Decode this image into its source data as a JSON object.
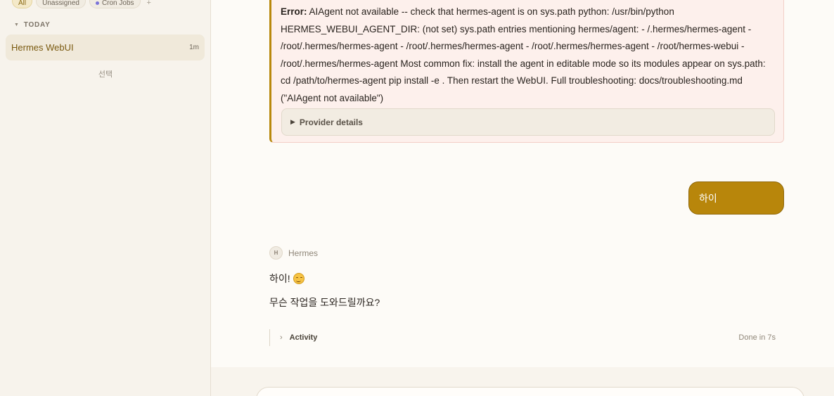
{
  "sidebar": {
    "filters": [
      {
        "label": "All",
        "active": true
      },
      {
        "label": "Unassigned",
        "active": false
      },
      {
        "label": "Cron Jobs",
        "active": false,
        "dot_color": "#7b74d9"
      }
    ],
    "add_filter_label": "+",
    "section": {
      "label": "TODAY"
    },
    "sessions": [
      {
        "title": "Hermes WebUI",
        "time": "1m"
      }
    ],
    "select_label": "선택"
  },
  "error": {
    "prefix": "Error:",
    "message": "AIAgent not available -- check that hermes-agent is on sys.path python: /usr/bin/python HERMES_WEBUI_AGENT_DIR: (not set) sys.path entries mentioning hermes/agent: - /.hermes/hermes-agent - /root/.hermes/hermes-agent - /root/.hermes/hermes-agent - /root/.hermes/hermes-agent - /root/hermes-webui - /root/.hermes/hermes-agent Most common fix: install the agent in editable mode so its modules appear on sys.path: cd /path/to/hermes-agent pip install -e . Then restart the WebUI. Full troubleshooting: docs/troubleshooting.md (\"AIAgent not available\")",
    "provider_details_label": "Provider details"
  },
  "user_message": "하이",
  "assistant": {
    "avatar_letter": "H",
    "name": "Hermes",
    "line1": "하이!",
    "line2": "무슨 작업을 도와드릴까요?",
    "activity_label": "Activity",
    "activity_status": "Done in 7s"
  },
  "colors": {
    "accent": "#b8860b",
    "error_bg": "#fdf0ec",
    "sidebar_bg": "#f7f3ec"
  }
}
